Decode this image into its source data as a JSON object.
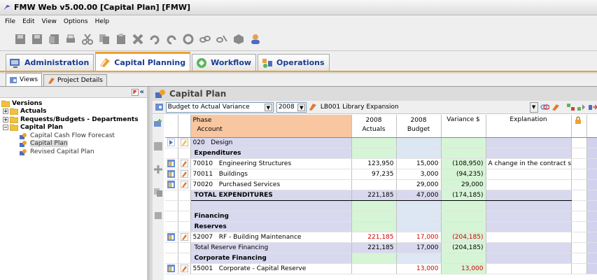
{
  "window": {
    "title": "FMW Web v5.00.00 [Capital Plan] [FMW]"
  },
  "menu": [
    "File",
    "Edit",
    "View",
    "Options",
    "Help"
  ],
  "main_tabs": [
    {
      "label": "Administration",
      "active": false
    },
    {
      "label": "Capital Planning",
      "active": true
    },
    {
      "label": "Workflow",
      "active": false
    },
    {
      "label": "Operations",
      "active": false
    }
  ],
  "sub_tabs": [
    {
      "label": "Views",
      "active": true
    },
    {
      "label": "Project Details",
      "active": false
    }
  ],
  "tree": {
    "root": "Versions",
    "items": [
      {
        "label": "Actuals",
        "level": 1
      },
      {
        "label": "Requests/Budgets - Departments",
        "level": 1
      },
      {
        "label": "Capital Plan",
        "level": 1
      },
      {
        "label": "Capital Cash Flow Forecast",
        "level": 2
      },
      {
        "label": "Capital Plan",
        "level": 2,
        "selected": true
      },
      {
        "label": "Revised Capital Plan",
        "level": 2
      }
    ]
  },
  "panel": {
    "title": "Capital Plan",
    "view_select": "Budget to Actual Variance",
    "year_select": "2008",
    "project": "LB001  Library Expansion"
  },
  "grid": {
    "headers": {
      "phase": "Phase",
      "account": "Account",
      "actuals_year": "2008",
      "actuals": "Actuals",
      "budget_year": "2008",
      "budget": "Budget",
      "variance": "Variance $",
      "explanation": "Explanation"
    },
    "rows": [
      {
        "type": "phase",
        "code": "020",
        "label": "Design"
      },
      {
        "type": "section",
        "label": "Expenditures"
      },
      {
        "type": "account",
        "code": "70010",
        "label": "Engineering Structures",
        "actuals": "123,950",
        "budget": "15,000",
        "variance": "(108,950)",
        "explanation": "A change in the contract s..."
      },
      {
        "type": "account",
        "code": "70011",
        "label": "Buildings",
        "actuals": "97,235",
        "budget": "3,000",
        "variance": "(94,235)",
        "explanation": ""
      },
      {
        "type": "account",
        "code": "70020",
        "label": "Purchased Services",
        "actuals": "",
        "budget": "29,000",
        "variance": "29,000",
        "explanation": ""
      },
      {
        "type": "total",
        "label": "TOTAL EXPENDITURES",
        "actuals": "221,185",
        "budget": "47,000",
        "variance": "(174,185)"
      },
      {
        "type": "blank"
      },
      {
        "type": "section",
        "label": "Financing"
      },
      {
        "type": "section",
        "label": "Reserves"
      },
      {
        "type": "account",
        "code": "52007",
        "label": "RF - Building Maintenance",
        "actuals": "221,185",
        "budget": "17,000",
        "variance": "(204,185)",
        "explanation": "",
        "red": true
      },
      {
        "type": "subtotal",
        "label": "Total Reserve Financing",
        "actuals": "221,185",
        "budget": "17,000",
        "variance": "(204,185)"
      },
      {
        "type": "section",
        "label": "Corporate Financing"
      },
      {
        "type": "account",
        "code": "55001",
        "label": "Corporate - Capital Reserve",
        "actuals": "",
        "budget": "13,000",
        "variance": "13,000",
        "explanation": "",
        "red": true
      }
    ]
  }
}
